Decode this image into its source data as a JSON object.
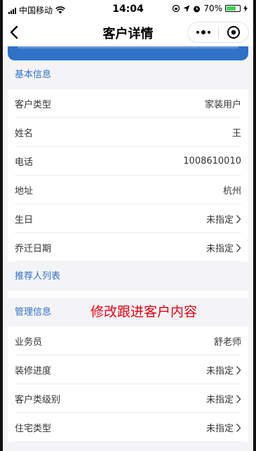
{
  "status_bar": {
    "carrier": "中国移动",
    "time": "14:04",
    "battery": "70%",
    "battery_level": 0.7,
    "battery_color": "#43d15a"
  },
  "nav": {
    "title": "客户详情"
  },
  "colors": {
    "accent": "#2f6fc6",
    "header_blue": "#2f72c8",
    "annotation": "#e60012"
  },
  "basic": {
    "header": "基本信息",
    "rows": [
      {
        "label": "客户类型",
        "value": "家装用户"
      },
      {
        "label": "姓名",
        "value": "王"
      },
      {
        "label": "电话",
        "value": "1008610010"
      },
      {
        "label": "地址",
        "value": "杭州"
      },
      {
        "label": "生日",
        "value": "未指定"
      },
      {
        "label": "乔迁日期",
        "value": "未指定"
      }
    ]
  },
  "referrers": {
    "header": "推荐人列表"
  },
  "manage": {
    "header": "管理信息",
    "annotation": "修改跟进客户内容",
    "rows": [
      {
        "label": "业务员",
        "value": "舒老师"
      },
      {
        "label": "装修进度",
        "value": "未指定"
      },
      {
        "label": "客户类级别",
        "value": "未指定"
      },
      {
        "label": "住宅类型",
        "value": "未指定"
      }
    ]
  }
}
